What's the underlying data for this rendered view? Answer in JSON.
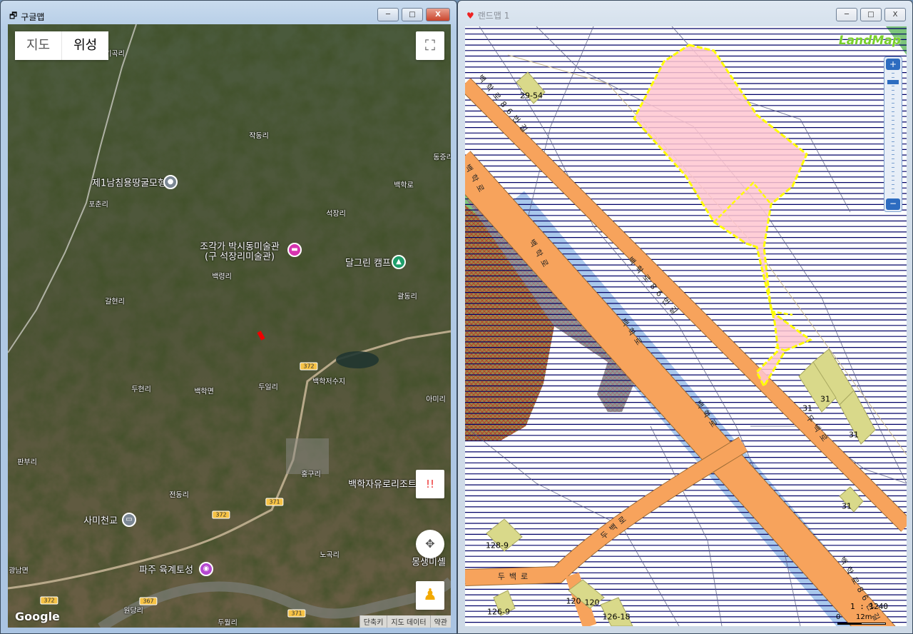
{
  "left_window": {
    "title": "구글맵",
    "buttons": {
      "minimize": "─",
      "maximize": "□",
      "close": "X"
    },
    "map_type": {
      "map": "지도",
      "satellite": "위성",
      "selected": "위성"
    },
    "fullscreen_icon": "fullscreen-icon",
    "report_button": "!!",
    "logo": "Google",
    "footer": [
      "단축키",
      "지도 데이터",
      "약관"
    ],
    "labels": [
      "기곡리",
      "작동리",
      "제1남침용땅굴모형",
      "포춘리",
      "석장리",
      "백학로",
      "조각가 박시동미술관",
      "(구 석장리미술관)",
      "달그린 캠프",
      "백령리",
      "갈현리",
      "괄동리",
      "두현리",
      "백학면",
      "두일리",
      "백학저수지",
      "아미리",
      "판부리",
      "홍구리",
      "백학자유로리조트",
      "전동리",
      "사미천교",
      "노곡리",
      "파주 육계토성",
      "몽생미셸",
      "광남면",
      "원당리",
      "두월리",
      "동중리"
    ],
    "route_shields": [
      "372",
      "372",
      "371",
      "371",
      "367",
      "372"
    ]
  },
  "right_window": {
    "title": "랜드맵 1",
    "buttons": {
      "minimize": "─",
      "maximize": "□",
      "close": "X"
    },
    "logo": "LandMap",
    "parcel_labels": [
      "29-54",
      "31",
      "31",
      "31",
      "31",
      "128-9",
      "126-9",
      "120",
      "120",
      "126-18"
    ],
    "road_labels": [
      "백학로",
      "백학로",
      "백학로",
      "백학로",
      "백학로86번길",
      "백학로86번길",
      "백학로86번길",
      "두백로",
      "두백로",
      "두백로"
    ],
    "scale": {
      "ratio": "1 : 1240",
      "zero": "0",
      "distance": "12m"
    },
    "colors": {
      "road": "#f7a35c",
      "parcel": "#d9d98a",
      "selection": "#ffc6d0",
      "selection_border": "#ffff00",
      "hatch": "#000066",
      "water": "#a9c8ec",
      "green": "#7cc47a"
    }
  }
}
